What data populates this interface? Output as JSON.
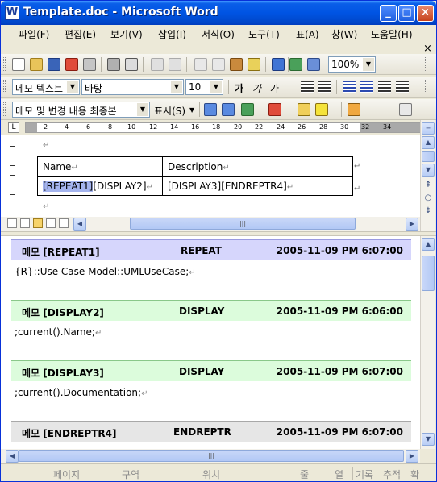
{
  "window": {
    "title": "Template.doc - Microsoft Word",
    "app_icon": "W"
  },
  "menu": [
    {
      "label": "파일(F)"
    },
    {
      "label": "편집(E)"
    },
    {
      "label": "보기(V)"
    },
    {
      "label": "삽입(I)"
    },
    {
      "label": "서식(O)"
    },
    {
      "label": "도구(T)"
    },
    {
      "label": "표(A)"
    },
    {
      "label": "창(W)"
    },
    {
      "label": "도움말(H)"
    }
  ],
  "menu_close": "×",
  "toolbar_standard": {
    "zoom": "100%"
  },
  "toolbar_format": {
    "style": "메모 텍스트",
    "font": "바탕",
    "size": "10",
    "bold": "가",
    "italic": "가",
    "underline": "가"
  },
  "toolbar_review": {
    "display_mode": "메모 및 변경 내용 최종본",
    "show_label": "표시(S)"
  },
  "ruler": {
    "ticks": [
      "2",
      "4",
      "6",
      "8",
      "10",
      "12",
      "14",
      "16",
      "18",
      "20",
      "22",
      "24",
      "26",
      "28",
      "30",
      "32",
      "34"
    ]
  },
  "table": {
    "headers": [
      "Name",
      "Description"
    ],
    "row": [
      "[REPEAT1]",
      "[DISPLAY2]",
      "[DISPLAY3][ENDREPTR4]"
    ]
  },
  "comments": [
    {
      "id": "메모 [REPEAT1]",
      "author": "REPEAT",
      "date": "2005-11-09 PM 6:07:00",
      "body": "{R}::Use Case Model::UMLUseCase;",
      "color": "#d6d6fc"
    },
    {
      "id": "메모 [DISPLAY2]",
      "author": "DISPLAY",
      "date": "2005-11-09 PM 6:06:00",
      "body": ";current().Name;",
      "color": "#dcfcdc"
    },
    {
      "id": "메모 [DISPLAY3]",
      "author": "DISPLAY",
      "date": "2005-11-09 PM 6:07:00",
      "body": ";current().Documentation;",
      "color": "#dcfcdc"
    },
    {
      "id": "메모 [ENDREPTR4]",
      "author": "ENDREPTR",
      "date": "2005-11-09 PM 6:07:00",
      "body": "",
      "color": "#e6e6e6"
    }
  ],
  "statusbar": [
    "페이지",
    "구역",
    "위치",
    "줄",
    "열",
    "기록",
    "추적",
    "확"
  ],
  "colors": {
    "title_bar": "#0054e3",
    "selection": "#a4b4ee"
  }
}
